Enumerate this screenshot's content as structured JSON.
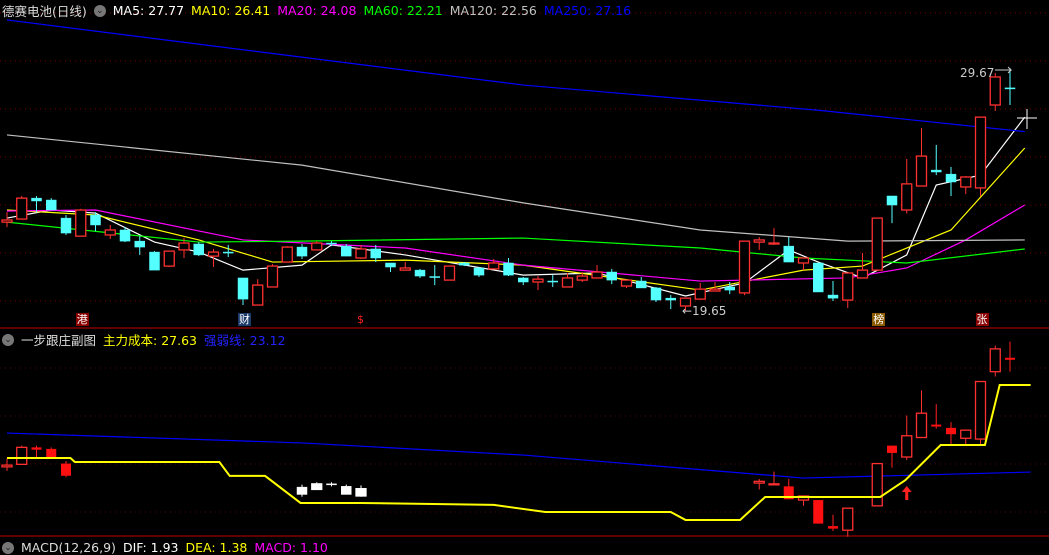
{
  "main_chart": {
    "title": "德赛电池(日线)",
    "ma_labels": [
      {
        "text": "MA5: 27.77",
        "color": "#ffffff"
      },
      {
        "text": "MA10: 26.41",
        "color": "#ffff00"
      },
      {
        "text": "MA20: 24.08",
        "color": "#ff00ff"
      },
      {
        "text": "MA60: 22.21",
        "color": "#00ff00"
      },
      {
        "text": "MA120: 22.56",
        "color": "#c0c0c0"
      },
      {
        "text": "MA250: 27.16",
        "color": "#0000ff"
      }
    ],
    "high_label": "29.67",
    "low_label": "←19.65",
    "price_range": [
      19.06,
      32.74
    ],
    "candles": [
      [
        23.39,
        23.81,
        23.18,
        23.48
      ],
      [
        23.52,
        24.49,
        23.52,
        24.4
      ],
      [
        24.4,
        24.49,
        23.81,
        24.28
      ],
      [
        24.32,
        24.4,
        23.9,
        23.9
      ],
      [
        23.56,
        23.69,
        22.85,
        22.93
      ],
      [
        22.8,
        23.95,
        22.8,
        23.9
      ],
      [
        23.69,
        23.81,
        23.01,
        23.27
      ],
      [
        22.85,
        23.27,
        22.68,
        23.06
      ],
      [
        23.06,
        23.18,
        22.55,
        22.59
      ],
      [
        22.59,
        22.8,
        22.01,
        22.34
      ],
      [
        22.13,
        22.17,
        21.37,
        21.37
      ],
      [
        21.54,
        21.58,
        21.5,
        22.17
      ],
      [
        22.22,
        22.72,
        21.88,
        22.51
      ],
      [
        22.47,
        22.55,
        21.96,
        22.01
      ],
      [
        21.96,
        22.26,
        21.5,
        22.13
      ],
      [
        22.13,
        22.43,
        21.92,
        22.11
      ],
      [
        21.04,
        21.04,
        19.9,
        20.15
      ],
      [
        19.9,
        20.99,
        19.9,
        20.74
      ],
      [
        20.66,
        21.62,
        20.66,
        21.54
      ],
      [
        21.71,
        22.38,
        21.71,
        22.34
      ],
      [
        22.34,
        22.47,
        21.84,
        21.96
      ],
      [
        22.22,
        22.59,
        22.22,
        22.51
      ],
      [
        22.51,
        22.59,
        22.38,
        22.47
      ],
      [
        22.38,
        22.47,
        21.96,
        21.96
      ],
      [
        21.88,
        22.43,
        21.84,
        22.26
      ],
      [
        22.26,
        22.43,
        21.71,
        21.88
      ],
      [
        21.67,
        21.67,
        21.29,
        21.5
      ],
      [
        21.37,
        21.71,
        21.37,
        21.46
      ],
      [
        21.37,
        21.42,
        21.04,
        21.12
      ],
      [
        21.1,
        21.58,
        20.74,
        21.06
      ],
      [
        20.95,
        21.54,
        20.95,
        21.54
      ],
      [
        21.67,
        21.71,
        21.54,
        21.58
      ],
      [
        21.46,
        21.5,
        21.08,
        21.16
      ],
      [
        21.42,
        21.84,
        21.42,
        21.67
      ],
      [
        21.67,
        21.88,
        21.12,
        21.16
      ],
      [
        21.04,
        21.08,
        20.74,
        20.87
      ],
      [
        20.87,
        21.12,
        20.53,
        20.99
      ],
      [
        20.91,
        21.16,
        20.66,
        20.89
      ],
      [
        20.66,
        21.25,
        20.66,
        21.04
      ],
      [
        20.95,
        21.29,
        20.87,
        21.12
      ],
      [
        21.04,
        21.58,
        21.04,
        21.29
      ],
      [
        21.29,
        21.42,
        20.78,
        20.95
      ],
      [
        20.7,
        20.95,
        20.62,
        20.95
      ],
      [
        20.91,
        21.08,
        20.62,
        20.62
      ],
      [
        20.62,
        20.66,
        20.03,
        20.11
      ],
      [
        20.19,
        20.32,
        19.73,
        20.11
      ],
      [
        19.86,
        20.19,
        19.65,
        20.19
      ],
      [
        20.15,
        20.83,
        20.15,
        20.57
      ],
      [
        20.49,
        20.87,
        20.49,
        20.57
      ],
      [
        20.66,
        20.87,
        20.36,
        20.53
      ],
      [
        20.41,
        22.59,
        20.32,
        22.59
      ],
      [
        22.55,
        22.76,
        22.22,
        22.64
      ],
      [
        22.47,
        23.14,
        22.43,
        22.51
      ],
      [
        22.38,
        22.76,
        21.71,
        21.71
      ],
      [
        21.67,
        21.88,
        21.37,
        21.88
      ],
      [
        21.67,
        21.67,
        20.45,
        20.45
      ],
      [
        20.32,
        20.91,
        20.07,
        20.19
      ],
      [
        20.11,
        21.25,
        19.77,
        21.25
      ],
      [
        21.04,
        22.09,
        21.04,
        21.37
      ],
      [
        21.37,
        23.56,
        21.37,
        23.56
      ],
      [
        24.49,
        24.49,
        23.35,
        24.11
      ],
      [
        23.9,
        26.05,
        23.75,
        25.0
      ],
      [
        24.91,
        27.35,
        24.91,
        26.17
      ],
      [
        25.58,
        26.64,
        25.37,
        25.5
      ],
      [
        25.41,
        25.71,
        24.49,
        25.08
      ],
      [
        24.87,
        25.33,
        24.57,
        25.29
      ],
      [
        24.83,
        27.81,
        24.49,
        27.81
      ],
      [
        28.32,
        29.67,
        28.07,
        29.5
      ],
      [
        29.04,
        29.88,
        28.32,
        29.0
      ]
    ],
    "ma_lines": [
      {
        "name": "MA5",
        "color": "#ffffff",
        "points": [
          [
            0,
            23.56
          ],
          [
            3,
            23.9
          ],
          [
            6,
            23.77
          ],
          [
            10,
            22.55
          ],
          [
            13,
            22.13
          ],
          [
            16,
            21.37
          ],
          [
            20,
            21.58
          ],
          [
            22,
            22.43
          ],
          [
            27,
            22.01
          ],
          [
            35,
            21.16
          ],
          [
            40,
            21.25
          ],
          [
            46,
            20.28
          ],
          [
            50,
            20.83
          ],
          [
            53,
            22.22
          ],
          [
            55,
            21.71
          ],
          [
            58,
            21.04
          ],
          [
            61,
            22.01
          ],
          [
            63,
            24.95
          ],
          [
            66,
            25.37
          ],
          [
            69,
            27.81
          ]
        ]
      },
      {
        "name": "MA10",
        "color": "#ffff00",
        "points": [
          [
            0,
            23.9
          ],
          [
            6,
            23.69
          ],
          [
            13,
            22.64
          ],
          [
            18,
            21.71
          ],
          [
            27,
            21.79
          ],
          [
            35,
            21.58
          ],
          [
            47,
            20.53
          ],
          [
            54,
            21.37
          ],
          [
            58,
            21.54
          ],
          [
            64,
            23.06
          ],
          [
            69,
            26.51
          ]
        ]
      },
      {
        "name": "MA20",
        "color": "#ff00ff",
        "points": [
          [
            0,
            23.86
          ],
          [
            6,
            23.9
          ],
          [
            16,
            22.64
          ],
          [
            27,
            22.3
          ],
          [
            35,
            21.58
          ],
          [
            47,
            20.91
          ],
          [
            57,
            21.04
          ],
          [
            61,
            21.46
          ],
          [
            65,
            22.64
          ],
          [
            69,
            24.11
          ]
        ]
      },
      {
        "name": "MA60",
        "color": "#00ff00",
        "points": [
          [
            0,
            23.39
          ],
          [
            13,
            22.55
          ],
          [
            20,
            22.59
          ],
          [
            35,
            22.72
          ],
          [
            47,
            22.3
          ],
          [
            54,
            21.88
          ],
          [
            61,
            21.67
          ],
          [
            69,
            22.26
          ]
        ]
      },
      {
        "name": "MA120",
        "color": "#c0c0c0",
        "points": [
          [
            0,
            27.06
          ],
          [
            20,
            25.79
          ],
          [
            35,
            24.2
          ],
          [
            47,
            23.06
          ],
          [
            57,
            22.59
          ],
          [
            69,
            22.64
          ]
        ]
      },
      {
        "name": "MA250",
        "color": "#0000ff",
        "points": [
          [
            0,
            31.9
          ],
          [
            35,
            29.16
          ],
          [
            55,
            28.1
          ],
          [
            69,
            27.2
          ]
        ]
      }
    ],
    "event_tags": [
      {
        "text": "港",
        "index": 5,
        "bg": "#8b0000",
        "color": "#ffffff"
      },
      {
        "text": "财",
        "index": 16,
        "bg": "#1a3a6a",
        "color": "#ffffff"
      },
      {
        "text": "$",
        "index": 24,
        "bg": "#000000",
        "color": "#ff2020"
      },
      {
        "text": "榜",
        "index": 59,
        "bg": "#8b5a00",
        "color": "#ffffff"
      },
      {
        "text": "张",
        "index": 66,
        "bg": "#8b0000",
        "color": "#ffffff"
      }
    ]
  },
  "sub_chart": {
    "title": "一步跟庄副图",
    "cost_label": "主力成本: 27.63",
    "strength_label": "强弱线: 23.12",
    "cost_color": "#ffff00",
    "strength_color": "#0000ff",
    "price_range": [
      17.97,
      30.01
    ],
    "visible_candles": [
      0,
      1,
      2,
      3,
      4,
      20,
      21,
      22,
      23,
      24,
      51,
      52,
      53,
      54,
      55,
      56,
      57,
      59,
      60,
      61,
      62,
      63,
      64,
      65,
      66,
      67,
      68,
      69
    ],
    "white_candles": [
      20,
      21,
      22,
      23,
      24
    ],
    "cost_line": [
      [
        0,
        23.85
      ],
      [
        4.3,
        23.85
      ],
      [
        4.6,
        23.64
      ],
      [
        14.4,
        23.64
      ],
      [
        15.1,
        22.92
      ],
      [
        17.5,
        22.92
      ],
      [
        19.9,
        21.52
      ],
      [
        24,
        21.52
      ],
      [
        33,
        21.42
      ],
      [
        36.5,
        21.05
      ],
      [
        45,
        21.05
      ],
      [
        46,
        20.64
      ],
      [
        49.7,
        20.64
      ],
      [
        51.4,
        21.83
      ],
      [
        59.2,
        21.83
      ],
      [
        60.9,
        22.7
      ],
      [
        63.3,
        24.52
      ],
      [
        66.3,
        24.52
      ],
      [
        67.3,
        27.63
      ],
      [
        69.4,
        27.63
      ]
    ],
    "strength_line": [
      [
        0,
        25.14
      ],
      [
        20,
        24.63
      ],
      [
        35,
        24.0
      ],
      [
        54,
        22.81
      ],
      [
        69.4,
        23.12
      ]
    ],
    "signal_arrow_index": 61
  },
  "macd_panel": {
    "title": "MACD(12,26,9)",
    "dif": "DIF: 1.93",
    "dea": "DEA: 1.38",
    "macd": "MACD: 1.10"
  }
}
